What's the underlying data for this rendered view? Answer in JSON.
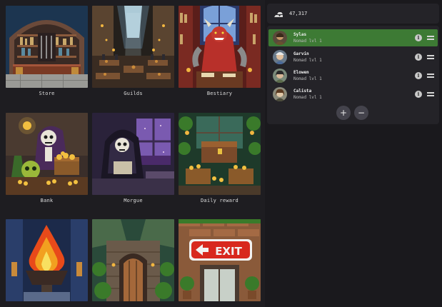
{
  "locations": [
    {
      "label": "Store"
    },
    {
      "label": "Guilds"
    },
    {
      "label": "Bestiary"
    },
    {
      "label": "Bank"
    },
    {
      "label": "Morgue"
    },
    {
      "label": "Daily reward"
    },
    {
      "label": ""
    },
    {
      "label": ""
    },
    {
      "label": ""
    }
  ],
  "exit_sign": "EXIT",
  "gold": {
    "icon": "gold-bars-icon",
    "value": "47,317"
  },
  "party": {
    "members": [
      {
        "name": "Sylas",
        "class": "Nomad lvl 1",
        "active": true
      },
      {
        "name": "Garvin",
        "class": "Nomad lvl 1",
        "active": false
      },
      {
        "name": "Elowen",
        "class": "Nomad lvl 1",
        "active": false
      },
      {
        "name": "Calista",
        "class": "Nomad lvl 1",
        "active": false
      }
    ],
    "add_label": "+",
    "remove_label": "−",
    "info_label": "i"
  },
  "colors": {
    "active_member": "#3d7a34",
    "panel": "#242328",
    "background": "#1b1a1e"
  }
}
